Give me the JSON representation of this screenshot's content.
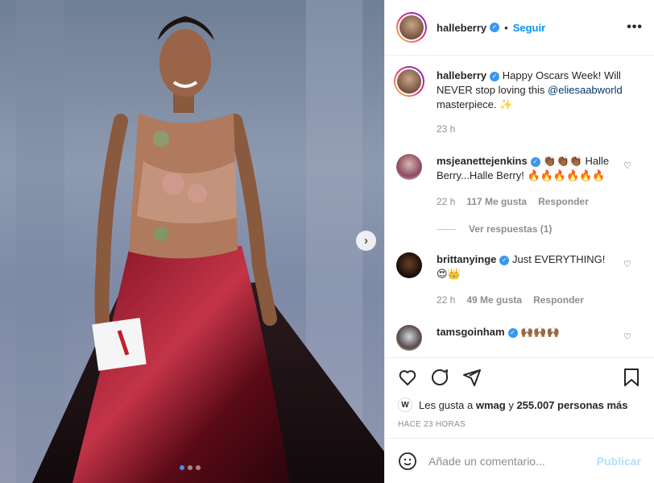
{
  "colors": {
    "accent": "#0095f6",
    "verified": "#3897f0",
    "muted": "#8e8e8e"
  },
  "header": {
    "username": "halleberry",
    "follow_label": "Seguir",
    "bullet": "•",
    "more": "•••"
  },
  "caption": {
    "username": "halleberry",
    "text_before": "Happy Oscars Week! Will NEVER stop loving this",
    "mention": "@eliesaabworld",
    "text_after": "masterpiece. ✨",
    "time": "23 h"
  },
  "comments": [
    {
      "username": "msjeanettejenkins",
      "text": "👏🏾👏🏾👏🏾 Halle Berry...Halle Berry! 🔥🔥🔥🔥🔥🔥",
      "time": "22 h",
      "likes": "117 Me gusta",
      "reply_label": "Responder",
      "view_replies": "Ver respuestas (1)",
      "verified": true
    },
    {
      "username": "brittanyinge",
      "text": "Just EVERYTHING! 😍👑",
      "time": "22 h",
      "likes": "49 Me gusta",
      "reply_label": "Responder",
      "verified": true
    },
    {
      "username": "tamsgoinham",
      "text": "🙌🏾🙌🏾🙌🏾",
      "verified": true
    }
  ],
  "likes_line": {
    "prefix": "Les gusta a",
    "user": "wmag",
    "middle": "y",
    "count": "255.007 personas más"
  },
  "post_time": "HACE 23 HORAS",
  "comment_box": {
    "placeholder": "Añade un comentario...",
    "publish_label": "Publicar"
  },
  "icons": [
    "heart-icon",
    "comment-icon",
    "share-icon",
    "bookmark-icon",
    "emoji-icon",
    "chevron-right-icon",
    "verified-icon"
  ],
  "carousel": {
    "current": 1,
    "total": 3
  }
}
